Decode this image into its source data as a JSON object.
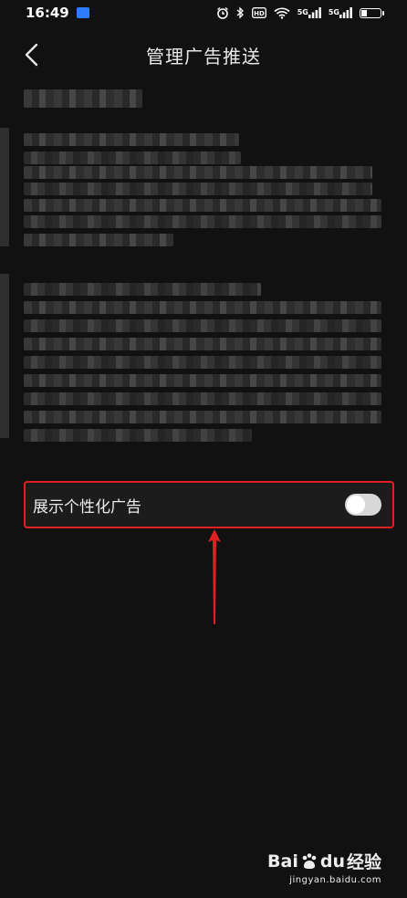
{
  "status_bar": {
    "time": "16:49",
    "network_tag_1": "5G",
    "network_tag_2": "5G",
    "icons": [
      "alarm-icon",
      "bluetooth-icon",
      "hd-icon",
      "wifi-icon",
      "signal-icon",
      "signal-icon",
      "battery-icon"
    ]
  },
  "header": {
    "title": "管理广告推送",
    "back_icon": "chevron-left-icon"
  },
  "settings": {
    "personalized_ads_label": "展示个性化广告",
    "personalized_ads_enabled": false
  },
  "watermark": {
    "logo_text_1": "Bai",
    "logo_text_2": "du",
    "logo_text_3": "经验",
    "url": "jingyan.baidu.com"
  },
  "colors": {
    "background": "#111111",
    "highlight_border": "#e02020",
    "switch_track": "#d8d8d8"
  }
}
